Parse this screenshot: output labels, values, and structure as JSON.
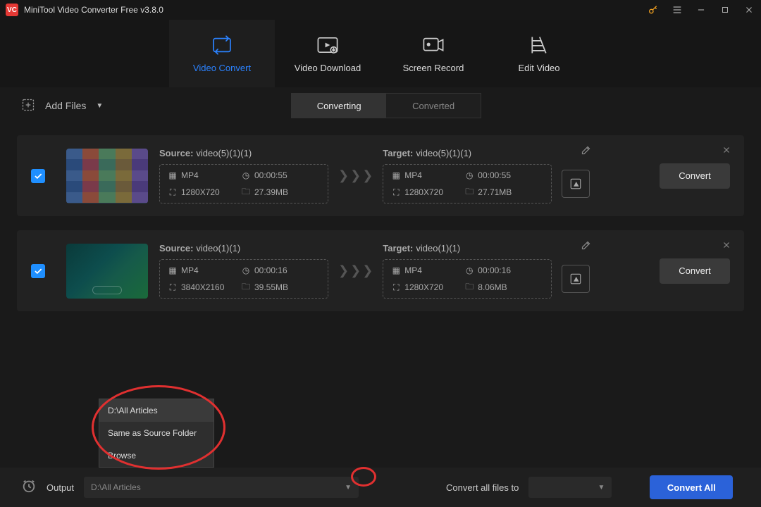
{
  "app": {
    "title": "MiniTool Video Converter Free v3.8.0"
  },
  "maintabs": {
    "convert": "Video Convert",
    "download": "Video Download",
    "record": "Screen Record",
    "edit": "Edit Video"
  },
  "toolbar": {
    "add_files": "Add Files",
    "converting": "Converting",
    "converted": "Converted"
  },
  "labels": {
    "source": "Source:",
    "target": "Target:",
    "convert": "Convert"
  },
  "files": [
    {
      "source_name": "video(5)(1)(1)",
      "target_name": "video(5)(1)(1)",
      "src": {
        "fmt": "MP4",
        "dur": "00:00:55",
        "res": "1280X720",
        "size": "27.39MB"
      },
      "tgt": {
        "fmt": "MP4",
        "dur": "00:00:55",
        "res": "1280X720",
        "size": "27.71MB"
      }
    },
    {
      "source_name": "video(1)(1)",
      "target_name": "video(1)(1)",
      "src": {
        "fmt": "MP4",
        "dur": "00:00:16",
        "res": "3840X2160",
        "size": "39.55MB"
      },
      "tgt": {
        "fmt": "MP4",
        "dur": "00:00:16",
        "res": "1280X720",
        "size": "8.06MB"
      }
    }
  ],
  "bottom": {
    "output_label": "Output",
    "output_value": "D:\\All Articles",
    "convert_all_files_to": "Convert all files to",
    "convert_all": "Convert All"
  },
  "output_menu": {
    "opt0": "D:\\All Articles",
    "opt1": "Same as Source Folder",
    "opt2": "Browse"
  }
}
